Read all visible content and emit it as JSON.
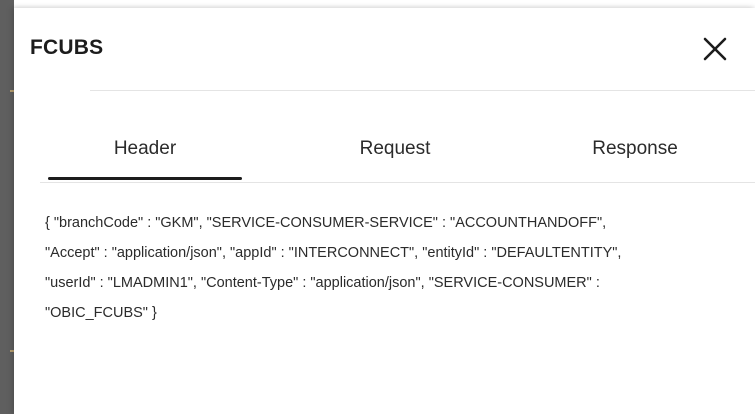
{
  "dialog": {
    "title": "FCUBS",
    "close_icon": "close-icon"
  },
  "tabs": [
    {
      "label": "Header",
      "selected": true
    },
    {
      "label": "Request",
      "selected": false
    },
    {
      "label": "Response",
      "selected": false
    }
  ],
  "payload": {
    "lines": [
      "{ \"branchCode\" : \"GKM\", \"SERVICE-CONSUMER-SERVICE\" : \"ACCOUNTHANDOFF\",",
      "\"Accept\" : \"application/json\", \"appId\" : \"INTERCONNECT\", \"entityId\" : \"DEFAULTENTITY\",",
      "\"userId\" : \"LMADMIN1\", \"Content-Type\" : \"application/json\", \"SERVICE-CONSUMER\" :",
      "\"OBIC_FCUBS\" }"
    ]
  },
  "colors": {
    "text": "#2b2b2b",
    "divider": "#e4e4e4",
    "selected_tab_underline": "#1c1c1c"
  }
}
